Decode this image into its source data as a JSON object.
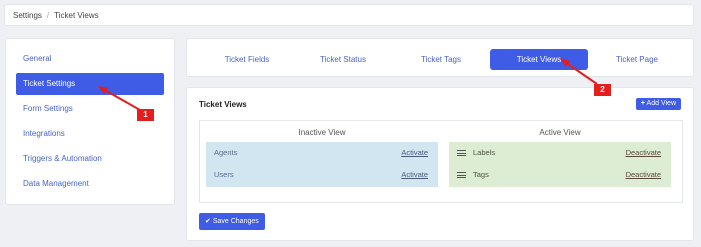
{
  "breadcrumb": {
    "root": "Settings",
    "separator": "/",
    "current": "Ticket Views"
  },
  "sidebar": {
    "items": [
      {
        "label": "General",
        "active": false
      },
      {
        "label": "Ticket Settings",
        "active": true
      },
      {
        "label": "Form Settings",
        "active": false
      },
      {
        "label": "Integrations",
        "active": false
      },
      {
        "label": "Triggers & Automation",
        "active": false
      },
      {
        "label": "Data Management",
        "active": false
      }
    ]
  },
  "tabs": {
    "items": [
      {
        "label": "Ticket Fields",
        "active": false
      },
      {
        "label": "Ticket Status",
        "active": false
      },
      {
        "label": "Ticket Tags",
        "active": false
      },
      {
        "label": "Ticket Views",
        "active": true
      },
      {
        "label": "Ticket Page",
        "active": false
      }
    ]
  },
  "panel": {
    "title": "Ticket Views",
    "add_button": "Add View",
    "inactive_header": "Inactive View",
    "active_header": "Active View",
    "inactive_items": [
      {
        "name": "Agents",
        "action": "Activate"
      },
      {
        "name": "Users",
        "action": "Activate"
      }
    ],
    "active_items": [
      {
        "name": "Labels",
        "action": "Deactivate"
      },
      {
        "name": "Tags",
        "action": "Deactivate"
      }
    ],
    "save_button": "Save Changes"
  },
  "annotations": {
    "badge1": "1",
    "badge2": "2"
  },
  "colors": {
    "accent": "#3f5ce6",
    "inactive_bg": "#d2e6f2",
    "active_bg": "#dcedd4",
    "annotation": "#e41e1e"
  }
}
